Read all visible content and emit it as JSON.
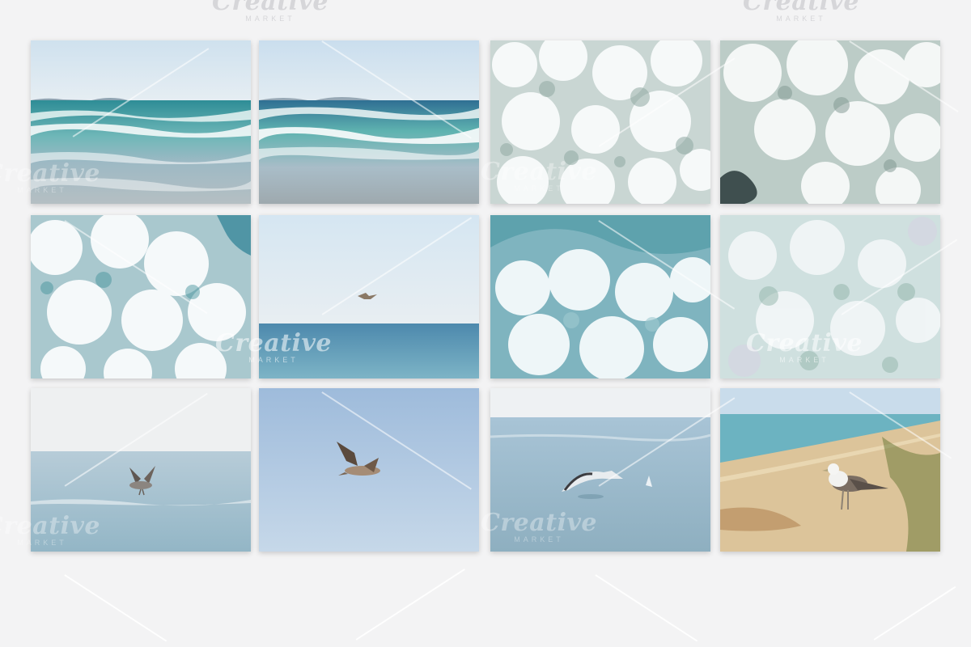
{
  "watermark": {
    "brand": "Creative",
    "sub": "MARKET"
  },
  "photos": [
    {
      "subject": "ocean-waves-horizon"
    },
    {
      "subject": "ocean-waves-horizon"
    },
    {
      "subject": "wave-foam-closeup"
    },
    {
      "subject": "wave-foam-closeup"
    },
    {
      "subject": "wave-foam-closeup"
    },
    {
      "subject": "seagull-over-sea"
    },
    {
      "subject": "wave-foam-closeup"
    },
    {
      "subject": "wave-foam-closeup"
    },
    {
      "subject": "seagull-taking-off"
    },
    {
      "subject": "seagull-in-sky"
    },
    {
      "subject": "seagull-on-water"
    },
    {
      "subject": "seagull-on-beach"
    }
  ],
  "colors": {
    "background": "#f3f3f4",
    "sky": "#c9dff0",
    "sea": "#5aa7bf",
    "sand": "#dcc49a"
  }
}
